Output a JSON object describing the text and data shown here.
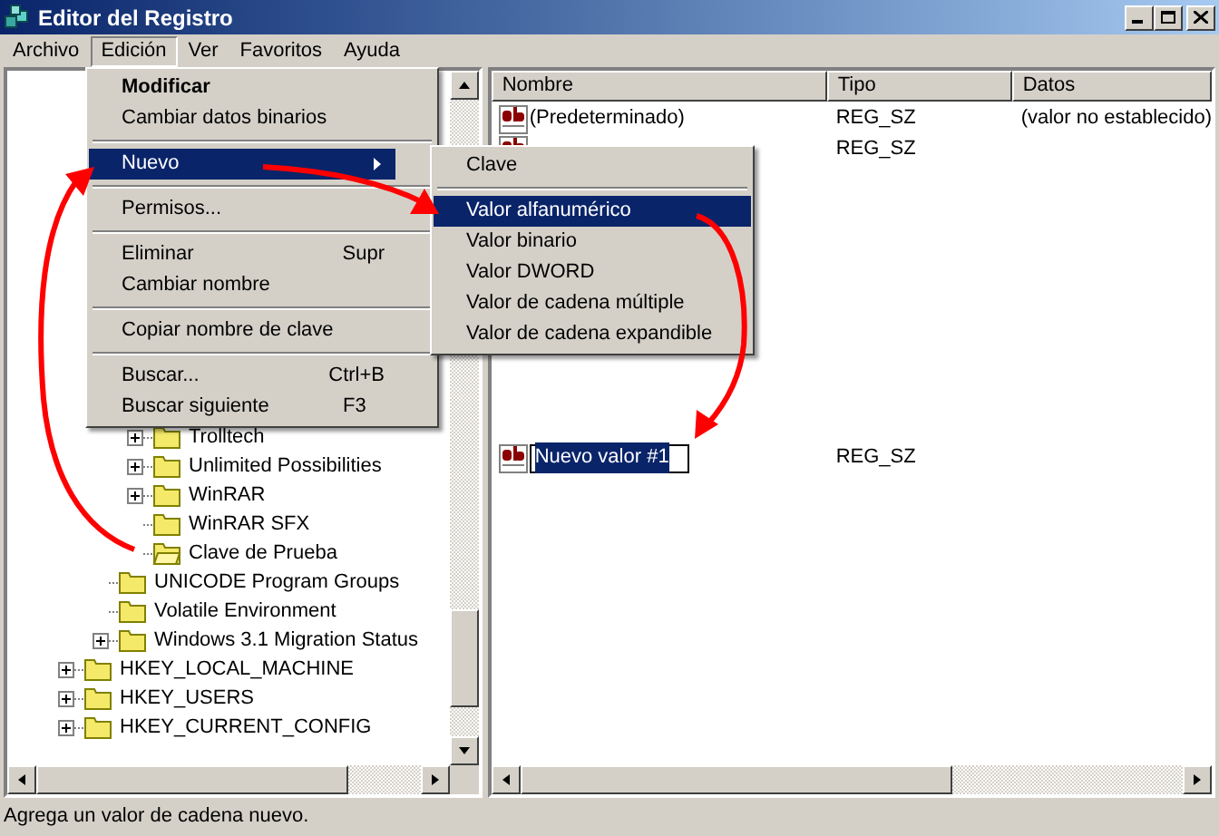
{
  "window": {
    "title": "Editor del Registro"
  },
  "menu_bar": [
    {
      "label": "Archivo",
      "selected": false
    },
    {
      "label": "Edición",
      "selected": true
    },
    {
      "label": "Ver",
      "selected": false
    },
    {
      "label": "Favoritos",
      "selected": false
    },
    {
      "label": "Ayuda",
      "selected": false
    }
  ],
  "edit_menu": [
    {
      "kind": "item",
      "label": "Modificar",
      "bold": true,
      "selected": false
    },
    {
      "kind": "item",
      "label": "Cambiar datos binarios",
      "bold": false,
      "selected": false
    },
    {
      "kind": "separator"
    },
    {
      "kind": "submenu",
      "label": "Nuevo",
      "bold": false,
      "selected": true
    },
    {
      "kind": "separator"
    },
    {
      "kind": "item",
      "label": "Permisos...",
      "bold": false,
      "selected": false
    },
    {
      "kind": "separator"
    },
    {
      "kind": "item",
      "label": "Eliminar",
      "shortcut": "Supr",
      "bold": false,
      "selected": false
    },
    {
      "kind": "item",
      "label": "Cambiar nombre",
      "bold": false,
      "selected": false
    },
    {
      "kind": "separator"
    },
    {
      "kind": "item",
      "label": "Copiar nombre de clave",
      "bold": false,
      "selected": false
    },
    {
      "kind": "separator"
    },
    {
      "kind": "item",
      "label": "Buscar...",
      "shortcut": "Ctrl+B",
      "bold": false,
      "selected": false
    },
    {
      "kind": "item",
      "label": "Buscar siguiente",
      "shortcut": "F3",
      "bold": false,
      "selected": false
    }
  ],
  "new_submenu": [
    {
      "kind": "item",
      "label": "Clave",
      "selected": false
    },
    {
      "kind": "separator"
    },
    {
      "kind": "item",
      "label": "Valor alfanumérico",
      "selected": true
    },
    {
      "kind": "item",
      "label": "Valor binario",
      "selected": false
    },
    {
      "kind": "item",
      "label": "Valor DWORD",
      "selected": false
    },
    {
      "kind": "item",
      "label": "Valor de cadena múltiple",
      "selected": false
    },
    {
      "kind": "item",
      "label": "Valor de cadena expandible",
      "selected": false
    }
  ],
  "tree": [
    {
      "children": [
        {
          "children": [
            {
              "label": "Trolltech",
              "expandable": true,
              "open": false
            },
            {
              "label": "Unlimited Possibilities",
              "expandable": true,
              "open": false
            },
            {
              "label": "WinRAR",
              "expandable": true,
              "open": false
            },
            {
              "label": "WinRAR SFX",
              "expandable": false,
              "open": false
            },
            {
              "label": "Clave de Prueba",
              "expandable": false,
              "open": true
            }
          ]
        },
        {
          "label": "UNICODE Program Groups",
          "expandable": false,
          "open": false
        },
        {
          "label": "Volatile Environment",
          "expandable": false,
          "open": false
        },
        {
          "label": "Windows 3.1 Migration Status",
          "expandable": true,
          "open": false
        }
      ]
    },
    {
      "label": "HKEY_LOCAL_MACHINE",
      "expandable": true,
      "open": false
    },
    {
      "label": "HKEY_USERS",
      "expandable": true,
      "open": false
    },
    {
      "label": "HKEY_CURRENT_CONFIG",
      "expandable": true,
      "open": false
    }
  ],
  "list": {
    "columns": [
      "Nombre",
      "Tipo",
      "Datos"
    ],
    "rows": [
      {
        "name": "(Predeterminado)",
        "type": "REG_SZ",
        "data": "(valor no establecido)",
        "editing": false
      },
      {
        "type": "REG_SZ",
        "editing": false
      },
      {
        "name": "Nuevo valor #1",
        "type": "REG_SZ",
        "editing": true
      }
    ]
  },
  "status_bar": "Agrega un valor de cadena nuevo."
}
